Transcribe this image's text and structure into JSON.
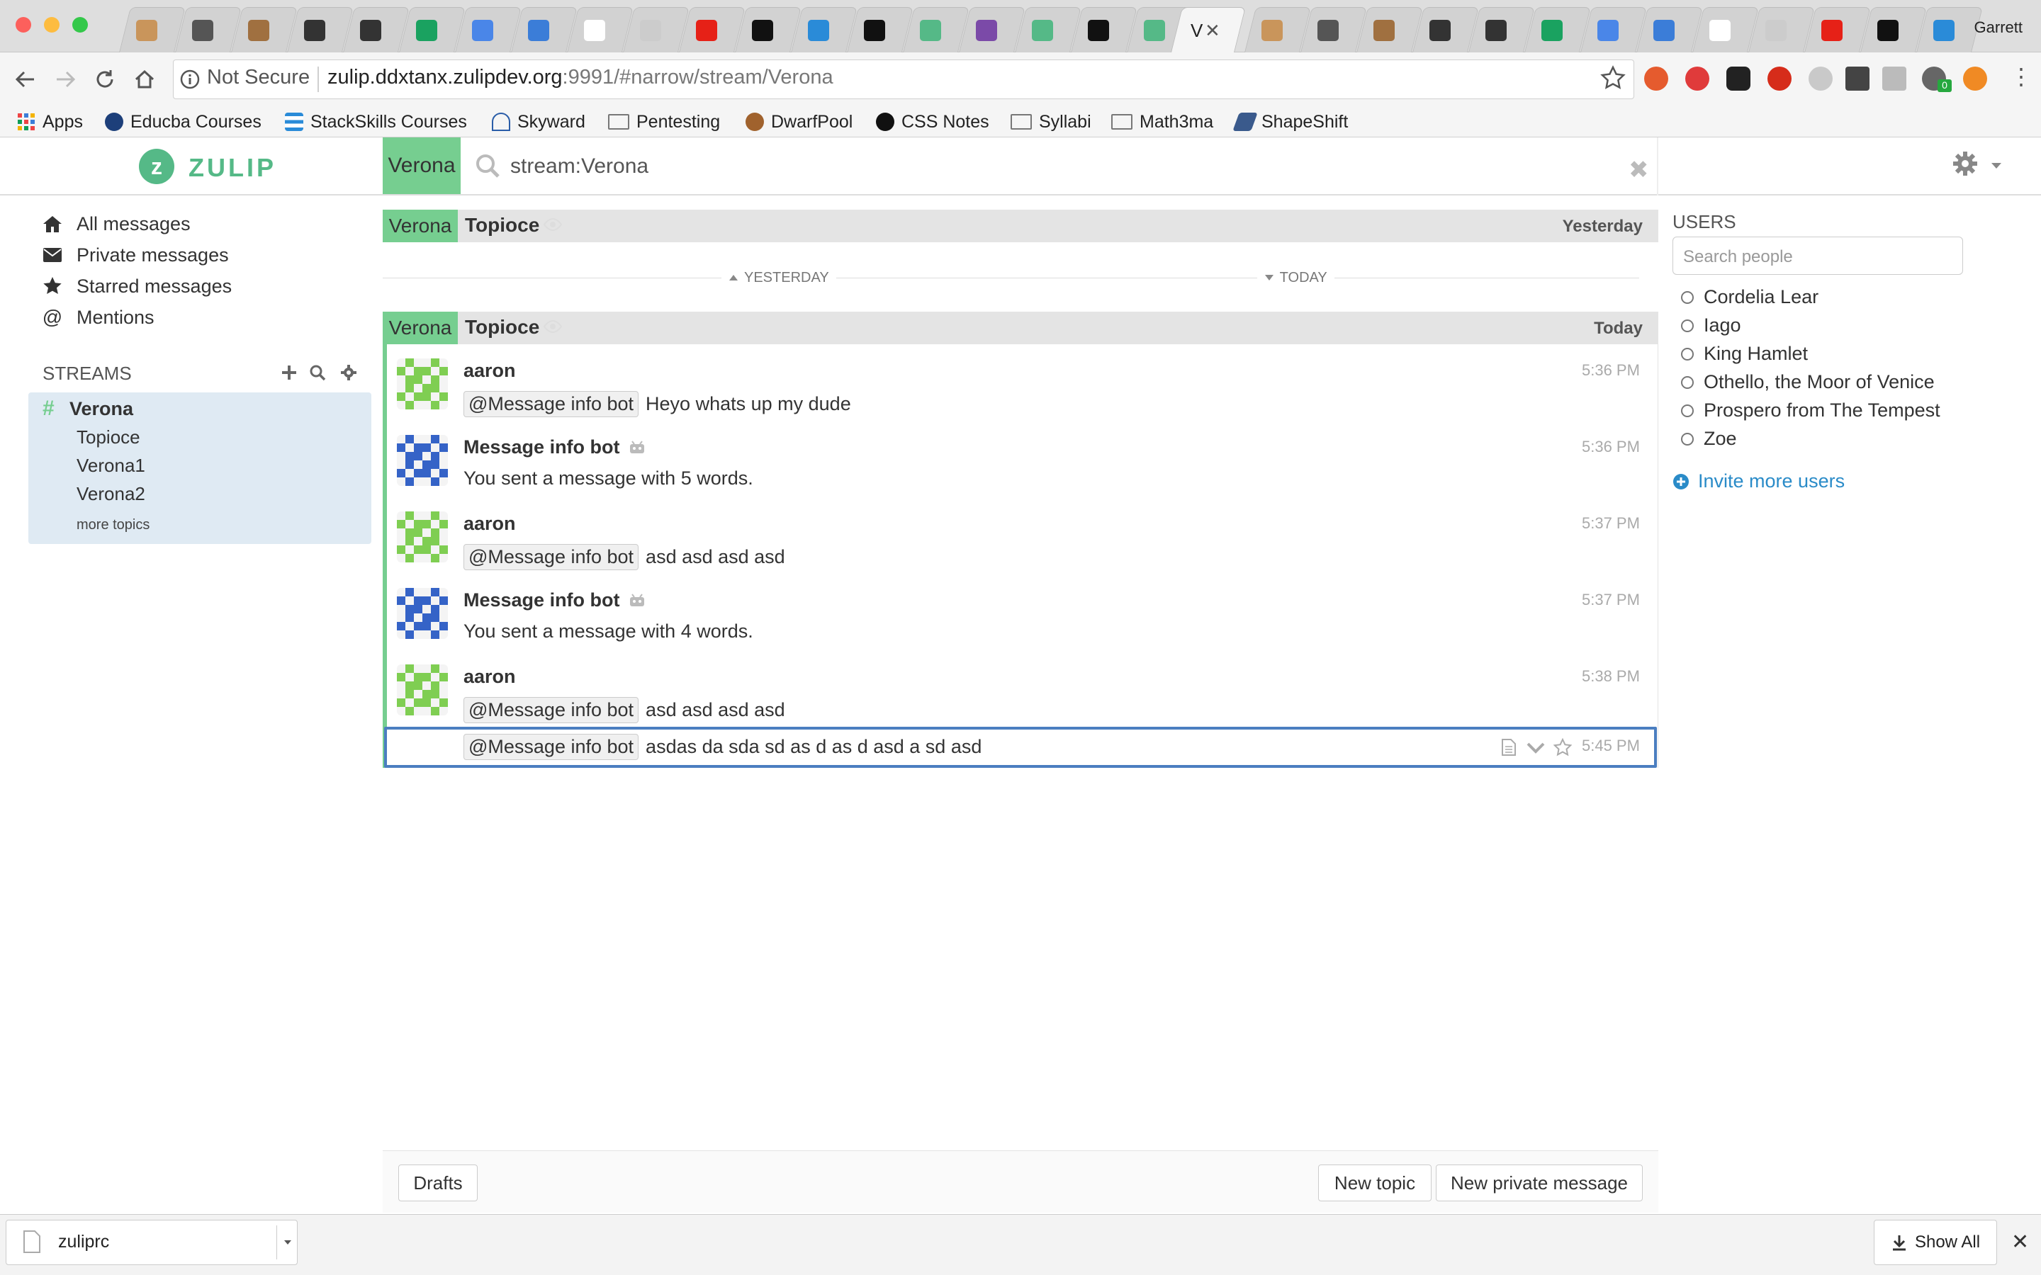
{
  "browser": {
    "profile_name": "Garrett",
    "tabs_active_title": "V",
    "security_label": "Not Secure",
    "url_host": "zulip.ddxtanx.zulipdev.org",
    "url_rest": ":9991/#narrow/stream/Verona",
    "bookmarks": [
      "Apps",
      "Educba Courses",
      "StackSkills Courses",
      "Skyward",
      "Pentesting",
      "DwarfPool",
      "CSS Notes",
      "Syllabi",
      "Math3ma",
      "ShapeShift"
    ]
  },
  "app": {
    "brand": "ZULIP",
    "narrow_chip": "Verona",
    "search_text": "stream:Verona",
    "accent": "#76ce90",
    "brand_color": "#55b987"
  },
  "left_sidebar": {
    "nav": [
      {
        "label": "All messages",
        "icon": "home-icon"
      },
      {
        "label": "Private messages",
        "icon": "envelope-icon"
      },
      {
        "label": "Starred messages",
        "icon": "star-icon"
      },
      {
        "label": "Mentions",
        "icon": "at-icon"
      }
    ],
    "streams_header": "STREAMS",
    "stream": {
      "name": "Verona",
      "topics": [
        "Topioce",
        "Verona1",
        "Verona2"
      ],
      "more_label": "more topics"
    }
  },
  "messages_view": {
    "top_recipient": {
      "stream": "Verona",
      "topic": "Topioce",
      "date": "Yesterday"
    },
    "date_separators": {
      "left": "YESTERDAY",
      "right": "TODAY"
    },
    "recipient": {
      "stream": "Verona",
      "topic": "Topioce",
      "date": "Today"
    },
    "messages": [
      {
        "sender": "aaron",
        "bot": false,
        "time": "5:36 PM",
        "mention": "@Message info bot",
        "text": "Heyo whats up my dude"
      },
      {
        "sender": "Message info bot",
        "bot": true,
        "time": "5:36 PM",
        "mention": "",
        "text": "You sent a message with 5 words."
      },
      {
        "sender": "aaron",
        "bot": false,
        "time": "5:37 PM",
        "mention": "@Message info bot",
        "text": "asd asd asd asd"
      },
      {
        "sender": "Message info bot",
        "bot": true,
        "time": "5:37 PM",
        "mention": "",
        "text": "You sent a message with 4 words."
      },
      {
        "sender": "aaron",
        "bot": false,
        "time": "5:38 PM",
        "mention": "@Message info bot",
        "text": "asd asd asd asd"
      }
    ],
    "selected_message": {
      "time": "5:45 PM",
      "mention": "@Message info bot",
      "text": "asdas da sda sd as d as d asd a sd asd"
    }
  },
  "right_sidebar": {
    "users_header": "USERS",
    "search_placeholder": "Search people",
    "users": [
      "Cordelia Lear",
      "Iago",
      "King Hamlet",
      "Othello, the Moor of Venice",
      "Prospero from The Tempest",
      "Zoe"
    ],
    "invite_label": "Invite more users"
  },
  "compose": {
    "drafts_label": "Drafts",
    "new_topic_label": "New topic",
    "new_pm_label": "New private message"
  },
  "downloads": {
    "file_name": "zuliprc",
    "show_all_label": "Show All"
  }
}
